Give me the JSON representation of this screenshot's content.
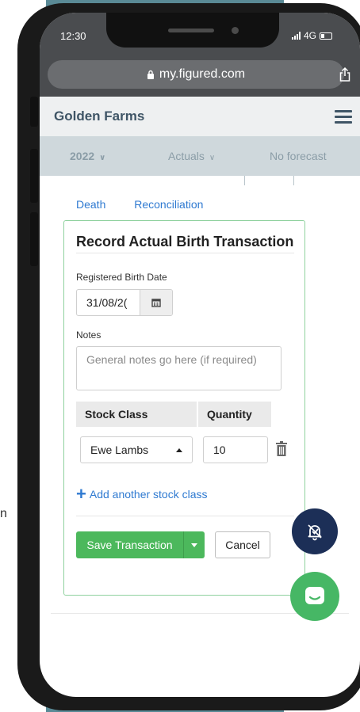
{
  "background": {
    "cut_text": "n"
  },
  "status_bar": {
    "time": "12:30",
    "network": "4G"
  },
  "browser": {
    "url": "my.figured.com"
  },
  "header": {
    "brand": "Golden Farms"
  },
  "filters": {
    "year": "2022",
    "mode": "Actuals",
    "forecast": "No forecast"
  },
  "tab_links": {
    "death": "Death",
    "reconciliation": "Reconciliation"
  },
  "form": {
    "title": "Record Actual Birth Transaction",
    "date_label": "Registered Birth Date",
    "date_value": "31/08/2(",
    "notes_label": "Notes",
    "notes_placeholder": "General notes go here (if required)",
    "col_stock_class": "Stock Class",
    "col_quantity": "Quantity",
    "stock_class_value": "Ewe Lambs",
    "quantity_value": "10",
    "add_stock_class": "Add another stock class",
    "save_label": "Save Transaction",
    "cancel_label": "Cancel"
  },
  "colors": {
    "accent_green": "#4cb85c",
    "link_blue": "#2f7ad1",
    "navy": "#1c2f57"
  }
}
